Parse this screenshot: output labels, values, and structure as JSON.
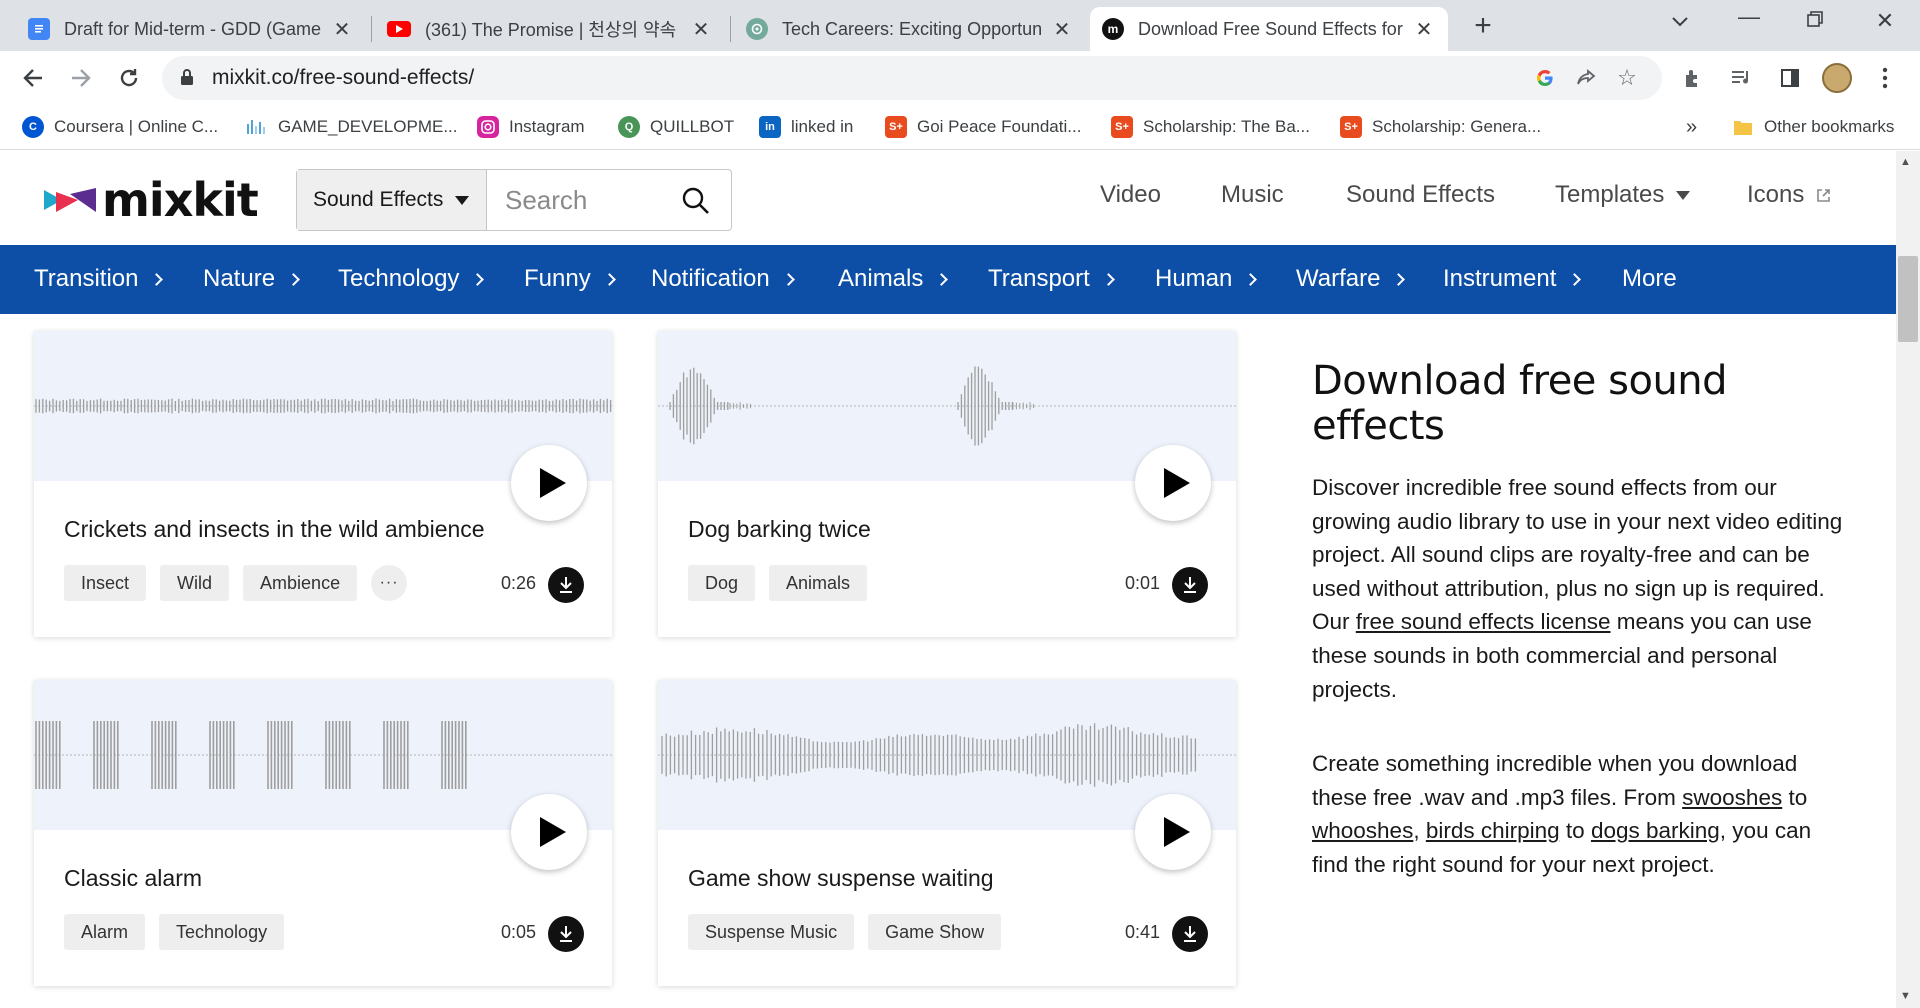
{
  "browser": {
    "tabs": [
      {
        "title": "Draft for Mid-term - GDD (Game",
        "icon": "google-docs-icon",
        "color": "#4285f4"
      },
      {
        "title": "(361) The Promise | 천상의 약속 |",
        "icon": "youtube-icon",
        "color": "#ff0000"
      },
      {
        "title": "Tech Careers: Exciting Opportunit",
        "icon": "chatgpt-icon",
        "color": "#74aa9c"
      },
      {
        "title": "Download Free Sound Effects for",
        "icon": "mixkit-favicon",
        "color": "#111111"
      }
    ],
    "url": "mixkit.co/free-sound-effects/",
    "bookmarks": [
      {
        "label": "Coursera | Online C...",
        "icon": "coursera-icon",
        "color": "#0056d2"
      },
      {
        "label": "GAME_DEVELOPME...",
        "icon": "audio-bars-icon",
        "color": "#4fa3d9"
      },
      {
        "label": "Instagram",
        "icon": "instagram-icon",
        "color": "#d6249f"
      },
      {
        "label": "QUILLBOT",
        "icon": "quillbot-icon",
        "color": "#499557"
      },
      {
        "label": "linked in",
        "icon": "linkedin-icon",
        "color": "#0a66c2"
      },
      {
        "label": "Goi Peace Foundati...",
        "icon": "scholarship-icon",
        "color": "#e84c1e"
      },
      {
        "label": "Scholarship: The Ba...",
        "icon": "scholarship-icon",
        "color": "#e84c1e"
      },
      {
        "label": "Scholarship: Genera...",
        "icon": "scholarship-icon",
        "color": "#e84c1e"
      }
    ],
    "bookmarks_overflow": "»",
    "other_bookmarks": "Other bookmarks"
  },
  "site": {
    "logo": "mixkit",
    "search": {
      "category": "Sound Effects",
      "placeholder": "Search"
    },
    "nav": [
      "Video",
      "Music",
      "Sound Effects",
      "Templates",
      "Icons"
    ],
    "categories": [
      "Transition",
      "Nature",
      "Technology",
      "Funny",
      "Notification",
      "Animals",
      "Transport",
      "Human",
      "Warfare",
      "Instrument",
      "More"
    ],
    "accent": "#0d4fa6"
  },
  "cards": [
    {
      "title": "Crickets and insects in the wild ambience",
      "tags": [
        "Insect",
        "Wild",
        "Ambience"
      ],
      "more": "···",
      "duration": "0:26",
      "wave": "dense"
    },
    {
      "title": "Dog barking twice",
      "tags": [
        "Dog",
        "Animals"
      ],
      "more": "",
      "duration": "0:01",
      "wave": "bursts"
    },
    {
      "title": "Classic alarm",
      "tags": [
        "Alarm",
        "Technology"
      ],
      "more": "",
      "duration": "0:05",
      "wave": "alarm"
    },
    {
      "title": "Game show suspense waiting",
      "tags": [
        "Suspense Music",
        "Game Show"
      ],
      "more": "",
      "duration": "0:41",
      "wave": "suspense"
    }
  ],
  "sidebar": {
    "heading": "Download free sound effects",
    "p1_a": "Discover incredible free sound effects from our growing audio library to use in your next video editing project. All sound clips are royalty-free and can be used without attribution, plus no sign up is required. Our ",
    "p1_link": "free sound effects license",
    "p1_b": " means you can use these sounds in both commercial and personal projects.",
    "p2_a": "Create something incredible when you download these free .wav and .mp3 files. From ",
    "p2_link1": "swooshes",
    "p2_to1": " to ",
    "p2_link2": "whooshes",
    "p2_comma": ", ",
    "p2_link3": "birds chirping",
    "p2_to2": " to ",
    "p2_link4": "dogs barking",
    "p2_b": ", you can find the right sound for your next project."
  }
}
